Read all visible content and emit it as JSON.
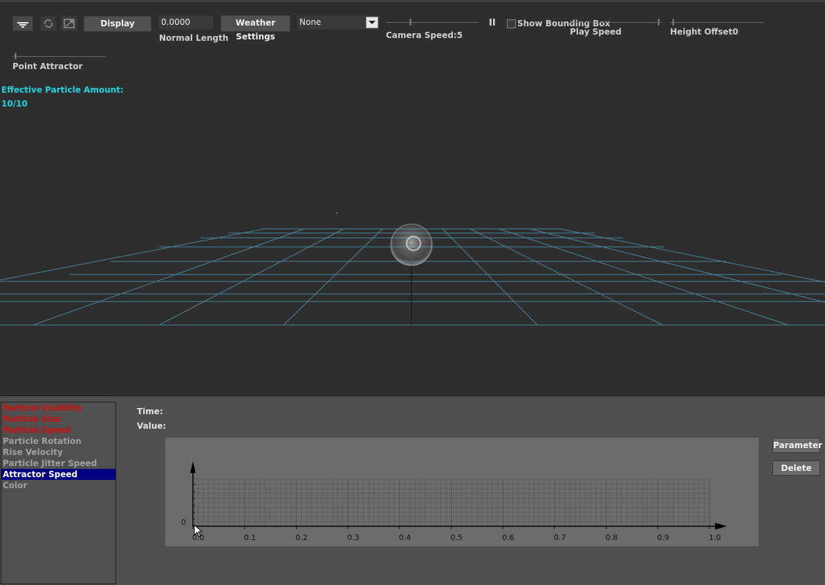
{
  "toolbar": {
    "display_button": "Display",
    "normal_length_value": "0.0000",
    "normal_length_label": "Normal Length",
    "weather_settings_button": "Weather Settings",
    "weather_select_value": "None",
    "camera_speed_label": "Camera Speed:5",
    "pause_glyph": "II",
    "show_bounding_box_label": "Show Bounding Box",
    "show_bounding_box_checked": false,
    "play_speed_label": "Play Speed",
    "height_offset_label": "Height Offset0",
    "point_attractor_label": "Point Attractor",
    "icons": [
      "filter-icon",
      "refresh-icon",
      "fit-view-icon"
    ],
    "sliders": {
      "camera_speed": 0.27,
      "play_speed": 0.95,
      "height_offset": 0.03,
      "point_attractor": 0.03
    }
  },
  "overlay": {
    "particle_amount_label": "Effective Particle Amount:",
    "particle_amount_value": "10/10",
    "accent_color": "#22d3e0"
  },
  "attributes": {
    "items": [
      {
        "label": "Particle Visibility",
        "state": "red"
      },
      {
        "label": "Particle Size",
        "state": "red"
      },
      {
        "label": "Particle Speed",
        "state": "red"
      },
      {
        "label": "Particle Rotation",
        "state": "grey"
      },
      {
        "label": "Rise Velocity",
        "state": "grey"
      },
      {
        "label": "Particle Jitter Speed",
        "state": "grey"
      },
      {
        "label": "Attractor Speed",
        "state": "selected"
      },
      {
        "label": "Color",
        "state": "grey"
      }
    ],
    "selected_color": "#000080",
    "active_color": "#d01010"
  },
  "editor": {
    "time_label": "Time:",
    "value_label": "Value:",
    "parameter_button": "Parameter",
    "delete_button": "Delete"
  },
  "chart_data": {
    "type": "line",
    "x_ticks": [
      "0.0",
      "0.1",
      "0.2",
      "0.3",
      "0.4",
      "0.5",
      "0.6",
      "0.7",
      "0.8",
      "0.9",
      "1.0"
    ],
    "y_ticks": [
      "0"
    ],
    "xlim": [
      0,
      1
    ],
    "grid": true,
    "series": []
  }
}
